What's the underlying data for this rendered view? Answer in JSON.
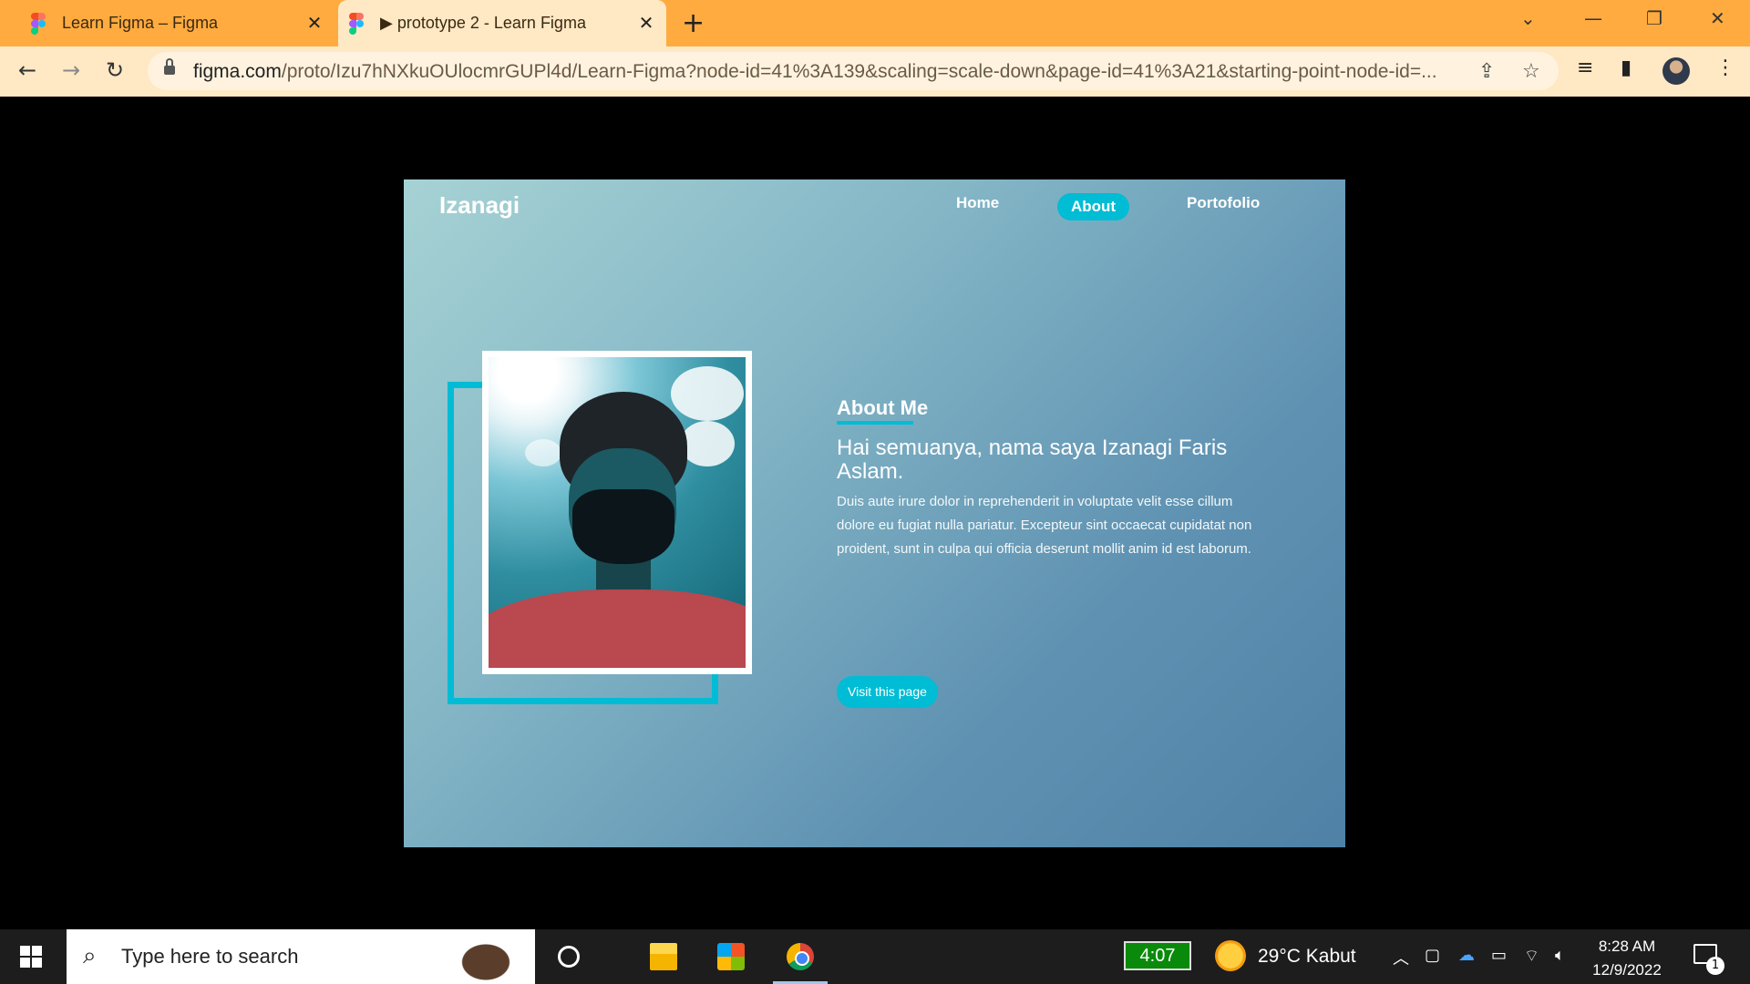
{
  "browser": {
    "tabs": [
      {
        "label": "Learn Figma – Figma",
        "active": false
      },
      {
        "label": "▶ prototype 2 - Learn Figma",
        "active": true
      }
    ],
    "new_tab_symbol": "+",
    "close_symbol": "✕",
    "url_host": "figma.com",
    "url_path": "/proto/Izu7hNXkuOUlocmrGUPl4d/Learn-Figma?node-id=41%3A139&scaling=scale-down&page-id=41%3A21&starting-point-node-id=...",
    "window_controls": {
      "tab_search": "⌄",
      "minimize": "—",
      "restore": "❐",
      "close": "✕"
    }
  },
  "site": {
    "logo": "Izanagi",
    "nav": {
      "home": "Home",
      "about": "About",
      "portfolio": "Portofolio"
    },
    "active_nav": "About",
    "accent_color": "#00bcd4",
    "about_title": "About Me",
    "headline": "Hai semuanya, nama saya Izanagi Faris Aslam.",
    "body": "Duis aute irure dolor in reprehenderit in voluptate velit esse cillum dolore eu fugiat nulla pariatur. Excepteur sint occaecat cupidatat non proident, sunt in culpa qui officia deserunt mollit anim id est laborum.",
    "cta": "Visit this page"
  },
  "taskbar": {
    "search_placeholder": "Type here to search",
    "battery_time": "4:07",
    "weather": "29°C  Kabut",
    "time": "8:28 AM",
    "date": "12/9/2022",
    "notification_count": "1"
  }
}
